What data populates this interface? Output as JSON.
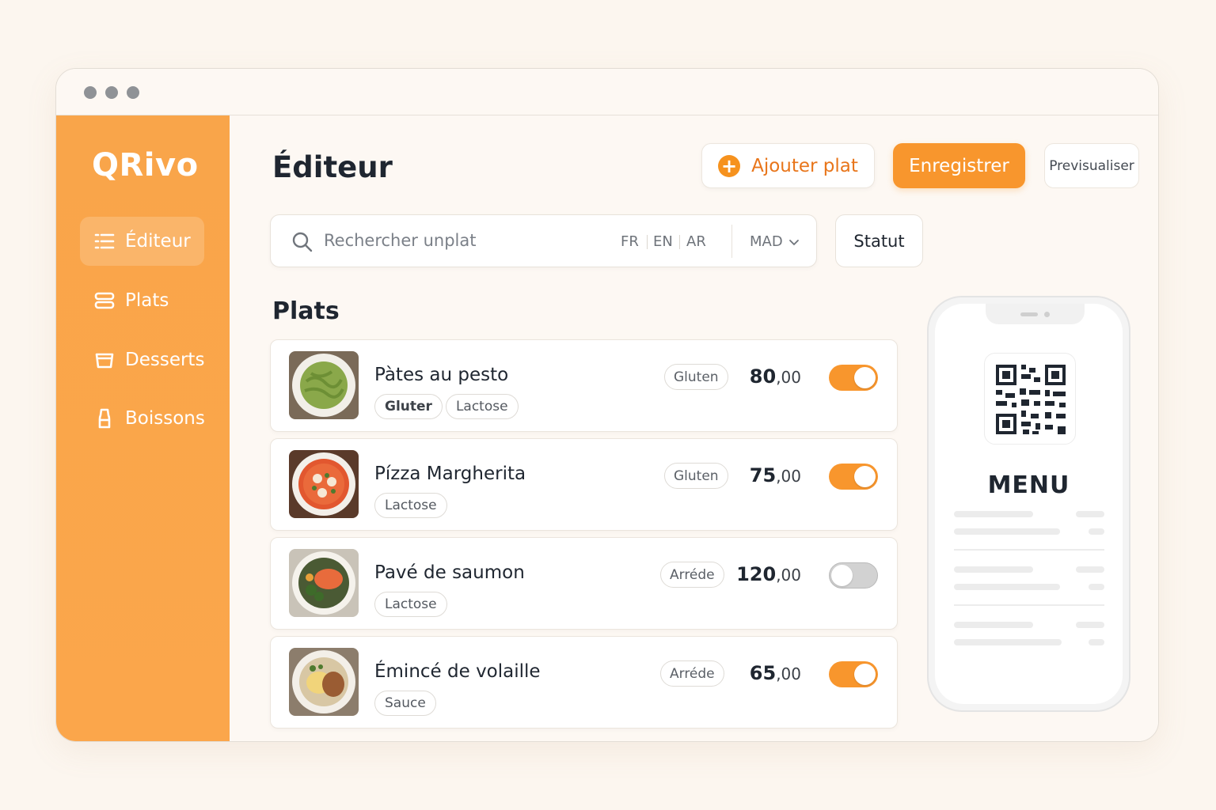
{
  "app": {
    "logo": "QRivo"
  },
  "colors": {
    "accent": "#f8962d",
    "sidebar": "#fba64b",
    "background": "#fcf6ef"
  },
  "sidebar": {
    "items": [
      {
        "label": "Éditeur",
        "icon": "list-icon",
        "active": true
      },
      {
        "label": "Plats",
        "icon": "dish-icon",
        "active": false
      },
      {
        "label": "Desserts",
        "icon": "dessert-icon",
        "active": false
      },
      {
        "label": "Boissons",
        "icon": "drink-icon",
        "active": false
      }
    ]
  },
  "header": {
    "title": "Éditeur",
    "add_label": "Ajouter plat",
    "save_label": "Enregistrer",
    "preview_label": "Previsualiser"
  },
  "search": {
    "placeholder": "Rechercher unplat",
    "languages": [
      "FR",
      "EN",
      "AR"
    ],
    "currency": "MAD",
    "status_label": "Statut"
  },
  "section_title": "Plats",
  "dishes": [
    {
      "name": "Pàtes au pesto",
      "tags": [
        "Gluter",
        "Lactose"
      ],
      "badge": "Gluten",
      "price_int": "80",
      "price_dec": ",00",
      "enabled": true
    },
    {
      "name": "Pízza Margherita",
      "tags": [
        "Lactose"
      ],
      "badge": "Gluten",
      "price_int": "75",
      "price_dec": ",00",
      "enabled": true
    },
    {
      "name": "Pavé de saumon",
      "tags": [
        "Lactose"
      ],
      "badge": "Arréde",
      "price_int": "120",
      "price_dec": ",00",
      "enabled": false
    },
    {
      "name": "Émincé de volaille",
      "tags": [
        "Sauce"
      ],
      "badge": "Arréde",
      "price_int": "65",
      "price_dec": ",00",
      "enabled": true
    }
  ],
  "phone": {
    "menu_label": "MENU"
  }
}
